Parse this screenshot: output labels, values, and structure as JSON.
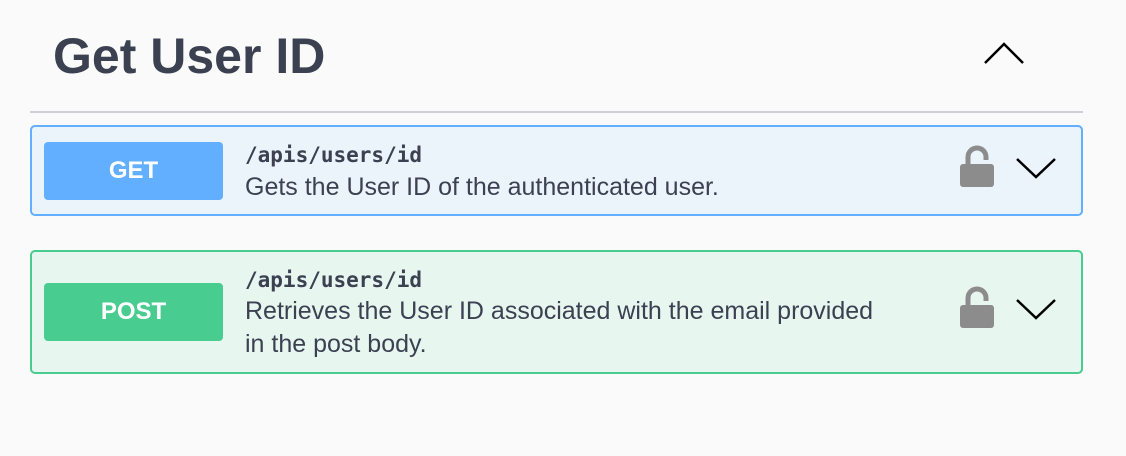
{
  "section": {
    "title": "Get User ID",
    "toggle_icon": "chevron-up-icon"
  },
  "operations": [
    {
      "method": "GET",
      "path": "/apis/users/id",
      "summary": "Gets the User ID of the authenticated user.",
      "color": "#61affe",
      "background": "#ebf3fb",
      "lock_icon": "unlocked-padlock-icon",
      "expand_icon": "chevron-down-icon"
    },
    {
      "method": "POST",
      "path": "/apis/users/id",
      "summary": "Retrieves the User ID associated with the email provided in the post body.",
      "color": "#49cc90",
      "background": "#e8f6f0",
      "lock_icon": "unlocked-padlock-icon",
      "expand_icon": "chevron-down-icon"
    }
  ],
  "colors": {
    "text": "#3b4151",
    "page_background": "#fafafa",
    "divider": "#cdd0d5",
    "lock": "#8c8c8c"
  }
}
